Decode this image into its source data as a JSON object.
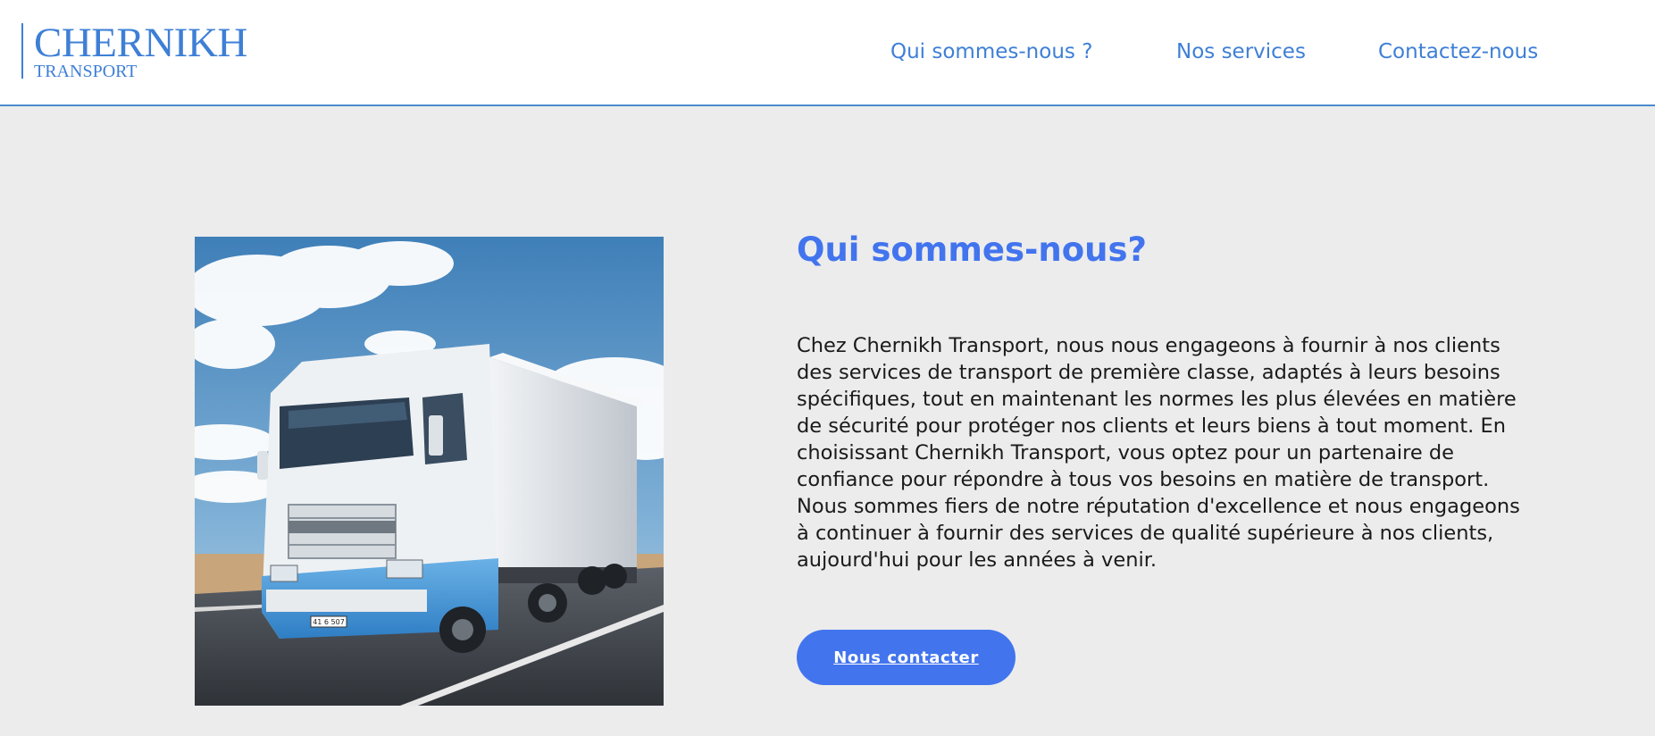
{
  "header": {
    "logo": {
      "main": "CHERNIKH",
      "sub": "TRANSPORT"
    },
    "nav": [
      {
        "label": "Qui sommes-nous ?"
      },
      {
        "label": "Nos services"
      },
      {
        "label": "Contactez-nous"
      }
    ]
  },
  "about": {
    "title": "Qui sommes-nous?",
    "paragraph": "Chez Chernikh Transport, nous nous engageons à fournir à nos clients des services de transport de première classe, adaptés à leurs besoins spécifiques, tout en maintenant les normes les plus élevées en matière de sécurité pour protéger nos clients et leurs biens à tout moment. En choisissant Chernikh Transport, vous optez pour un partenaire de confiance pour répondre à tous vos besoins en matière de transport. Nous sommes fiers de notre réputation d'excellence et nous engageons à continuer à fournir des services de qualité supérieure à nos clients, aujourd'hui pour les années à venir.",
    "cta_label": "Nous contacter",
    "image_plate": "41 6 507"
  },
  "colors": {
    "brand": "#3e7fd6",
    "accent": "#4274ee",
    "background": "#ececec",
    "header_border": "#4a8ccf"
  }
}
